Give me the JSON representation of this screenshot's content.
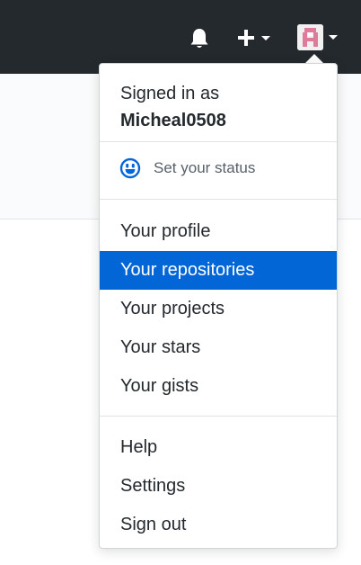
{
  "header": {
    "bell_icon": "bell-icon",
    "plus_icon": "plus-icon",
    "avatar_icon": "avatar-identicon"
  },
  "dropdown": {
    "signed_in_label": "Signed in as",
    "username": "Micheal0508",
    "status_icon": "smiley-icon",
    "status_label": "Set your status",
    "items_group_1": [
      {
        "label": "Your profile",
        "active": false
      },
      {
        "label": "Your repositories",
        "active": true
      },
      {
        "label": "Your projects",
        "active": false
      },
      {
        "label": "Your stars",
        "active": false
      },
      {
        "label": "Your gists",
        "active": false
      }
    ],
    "items_group_2": [
      {
        "label": "Help"
      },
      {
        "label": "Settings"
      },
      {
        "label": "Sign out"
      }
    ]
  },
  "colors": {
    "header_bg": "#24292e",
    "active_item_bg": "#0366d6",
    "status_icon_color": "#0366d6",
    "avatar_color": "#e07a9b"
  }
}
